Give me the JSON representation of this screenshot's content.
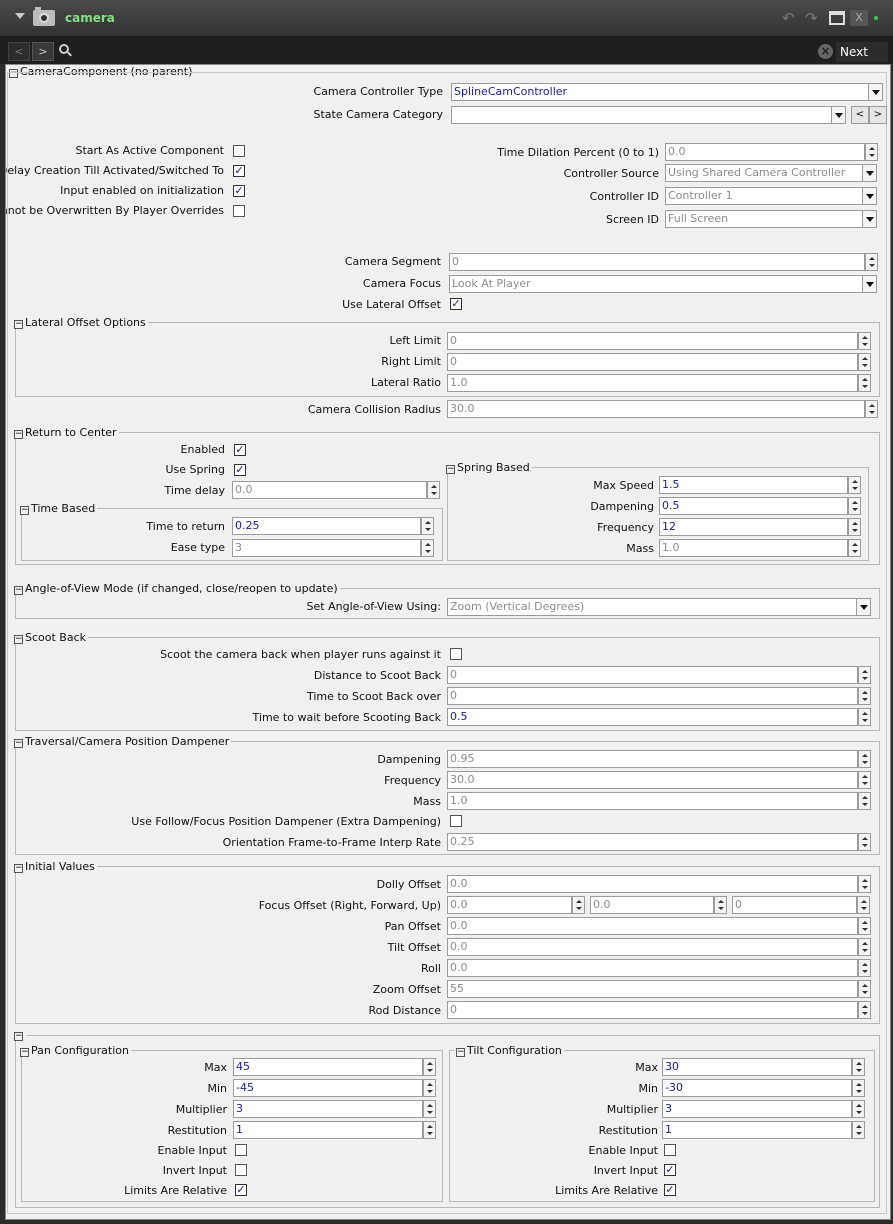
{
  "window": {
    "title": "camera",
    "nav_prev": "<",
    "nav_next": ">",
    "next_label": "Next",
    "clear": "×",
    "minimize": "▬",
    "close": "X"
  },
  "camera": {
    "section_title": "CameraComponent (no parent)",
    "controller_type": {
      "label": "Camera Controller Type",
      "value": "SplineCamController"
    },
    "state_category": {
      "label": "State Camera Category",
      "value": "",
      "prev": "<",
      "next": ">"
    },
    "start_active": {
      "label": "Start As Active Component",
      "checked": "false"
    },
    "delay_creation": {
      "label": "Delay Creation Till Activated/Switched To",
      "checked": "true"
    },
    "input_enabled": {
      "label": "Input enabled on initialization",
      "checked": "true"
    },
    "no_overwrite": {
      "label": "Cannot be Overwritten By Player Overrides",
      "checked": "false"
    },
    "time_dilation": {
      "label": "Time Dilation Percent (0 to 1)",
      "value": "0.0"
    },
    "controller_source": {
      "label": "Controller Source",
      "value": "Using Shared Camera Controller"
    },
    "controller_id": {
      "label": "Controller ID",
      "value": "Controller 1"
    },
    "screen_id": {
      "label": "Screen ID",
      "value": "Full Screen"
    },
    "segment": {
      "label": "Camera Segment",
      "value": "0"
    },
    "focus": {
      "label": "Camera Focus",
      "value": "Look At Player"
    },
    "lateral_offset": {
      "label": "Use Lateral Offset",
      "checked": "true"
    }
  },
  "lateral": {
    "title": "Lateral Offset Options",
    "left": {
      "label": "Left Limit",
      "value": "0"
    },
    "right": {
      "label": "Right Limit",
      "value": "0"
    },
    "ratio": {
      "label": "Lateral Ratio",
      "value": "1.0"
    }
  },
  "collision": {
    "label": "Camera Collision Radius",
    "value": "30.0"
  },
  "return_center": {
    "title": "Return to Center",
    "enabled": {
      "label": "Enabled",
      "checked": "true"
    },
    "use_spring": {
      "label": "Use Spring",
      "checked": "true"
    },
    "time_delay": {
      "label": "Time delay",
      "value": "0.0"
    },
    "time_based": {
      "title": "Time Based",
      "time_to_return": {
        "label": "Time to return",
        "value": "0.25"
      },
      "ease_type": {
        "label": "Ease type",
        "value": "3"
      }
    },
    "spring": {
      "title": "Spring Based",
      "max_speed": {
        "label": "Max Speed",
        "value": "1.5"
      },
      "dampening": {
        "label": "Dampening",
        "value": "0.5"
      },
      "frequency": {
        "label": "Frequency",
        "value": "12"
      },
      "mass": {
        "label": "Mass",
        "value": "1.0"
      }
    }
  },
  "aov": {
    "title": "Angle-of-View Mode (if changed, close/reopen to update)",
    "set_using": {
      "label": "Set Angle-of-View Using:",
      "value": "Zoom (Vertical Degrees)"
    }
  },
  "scoot": {
    "title": "Scoot Back",
    "enable": {
      "label": "Scoot the camera back when player runs against it",
      "checked": "false"
    },
    "distance": {
      "label": "Distance to Scoot Back",
      "value": "0"
    },
    "time_over": {
      "label": "Time to Scoot Back over",
      "value": "0"
    },
    "wait": {
      "label": "Time to wait before Scooting Back",
      "value": "0.5"
    }
  },
  "traversal": {
    "title": "Traversal/Camera Position Dampener",
    "dampening": {
      "label": "Dampening",
      "value": "0.95"
    },
    "frequency": {
      "label": "Frequency",
      "value": "30.0"
    },
    "mass": {
      "label": "Mass",
      "value": "1.0"
    },
    "follow": {
      "label": "Use Follow/Focus Position Dampener (Extra Dampening)",
      "checked": "false"
    },
    "orientation": {
      "label": "Orientation Frame-to-Frame Interp Rate",
      "value": "0.25"
    }
  },
  "initial": {
    "title": "Initial Values",
    "dolly": {
      "label": "Dolly Offset",
      "value": "0.0"
    },
    "focus_offset": {
      "label": "Focus Offset (Right, Forward, Up)",
      "values": [
        "0.0",
        "0.0",
        "0"
      ]
    },
    "pan": {
      "label": "Pan Offset",
      "value": "0.0"
    },
    "tilt": {
      "label": "Tilt Offset",
      "value": "0.0"
    },
    "roll": {
      "label": "Roll",
      "value": "0.0"
    },
    "zoom": {
      "label": "Zoom Offset",
      "value": "55"
    },
    "rod": {
      "label": "Rod Distance",
      "value": "0"
    }
  },
  "pan_cfg": {
    "title": "Pan Configuration",
    "max": {
      "label": "Max",
      "value": "45"
    },
    "min": {
      "label": "Min",
      "value": "-45"
    },
    "multiplier": {
      "label": "Multiplier",
      "value": "3"
    },
    "restitution": {
      "label": "Restitution",
      "value": "1"
    },
    "enable_input": {
      "label": "Enable Input",
      "checked": "false"
    },
    "invert_input": {
      "label": "Invert Input",
      "checked": "false"
    },
    "limits_relative": {
      "label": "Limits Are Relative",
      "checked": "true"
    }
  },
  "tilt_cfg": {
    "title": "Tilt Configuration",
    "max": {
      "label": "Max",
      "value": "30"
    },
    "min": {
      "label": "Min",
      "value": "-30"
    },
    "multiplier": {
      "label": "Multiplier",
      "value": "3"
    },
    "restitution": {
      "label": "Restitution",
      "value": "1"
    },
    "enable_input": {
      "label": "Enable Input",
      "checked": "false"
    },
    "invert_input": {
      "label": "Invert Input",
      "checked": "true"
    },
    "limits_relative": {
      "label": "Limits Are Relative",
      "checked": "true"
    }
  },
  "colors": {
    "title_text": "#7fe07f",
    "active_value": "#1a1a9c",
    "disabled_value": "#8c8c8c",
    "panel_bg": "#f0f0f0"
  }
}
